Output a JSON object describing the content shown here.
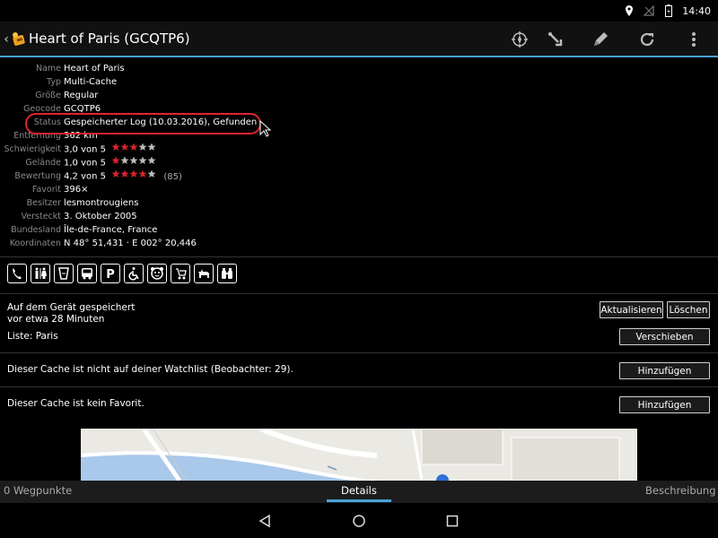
{
  "status_bar": {
    "time": "14:40",
    "icons": [
      "location-icon",
      "signal-icon",
      "battery-icon"
    ]
  },
  "action_bar": {
    "back_glyph": "‹",
    "title": "Heart of Paris (GCQTP6)",
    "actions": [
      "compass-icon",
      "navigate-icon",
      "edit-icon",
      "refresh-icon",
      "overflow-menu-icon"
    ]
  },
  "details": [
    {
      "label": "Name",
      "value": "Heart of Paris"
    },
    {
      "label": "Typ",
      "value": "Multi-Cache"
    },
    {
      "label": "Größe",
      "value": "Regular"
    },
    {
      "label": "Geocode",
      "value": "GCQTP6"
    },
    {
      "label": "Status",
      "value": "Gespeicherter Log (10.03.2016), Gefunden"
    },
    {
      "label": "Entfernung",
      "value": "362 km"
    },
    {
      "label": "Schwierigkeit",
      "value": "3,0 von 5",
      "stars": 3
    },
    {
      "label": "Gelände",
      "value": "1,0 von 5",
      "stars": 1
    },
    {
      "label": "Bewertung",
      "value": "4,2 von 5",
      "stars": 4,
      "votes": "(85)"
    },
    {
      "label": "Favorit",
      "value": "396×"
    },
    {
      "label": "Besitzer",
      "value": "lesmontrougiens"
    },
    {
      "label": "Versteckt",
      "value": "3. Oktober 2005"
    },
    {
      "label": "Bundesland",
      "value": "Île-de-France, France"
    },
    {
      "label": "Koordinaten",
      "value": "N 48° 51,431 · E 002° 20,446"
    }
  ],
  "attributes": [
    "phone-icon",
    "restroom-icon",
    "drinking-water-icon",
    "bus-icon",
    "parking-icon",
    "wheelchair-icon",
    "kids-icon",
    "stroller-icon",
    "dog-icon",
    "binoculars-icon"
  ],
  "storage": {
    "line1": "Auf dem Gerät gespeichert",
    "line2": "vor etwa 28 Minuten",
    "list": "Liste: Paris",
    "refresh_label": "Aktualisieren",
    "delete_label": "Löschen",
    "move_label": "Verschieben"
  },
  "watchlist": {
    "text": "Dieser Cache ist nicht auf deiner Watchlist (Beobachter: 29).",
    "add_label": "Hinzufügen"
  },
  "favorite": {
    "text": "Dieser Cache ist kein Favorit.",
    "add_label": "Hinzufügen"
  },
  "tabs": {
    "left": "0 Wegpunkte",
    "center": "Details",
    "right": "Beschreibung"
  },
  "colors": {
    "accent": "#4aa3d6",
    "highlight": "#e0242e",
    "star_filled": "#d9232e",
    "star_empty": "#bbbbbb"
  }
}
